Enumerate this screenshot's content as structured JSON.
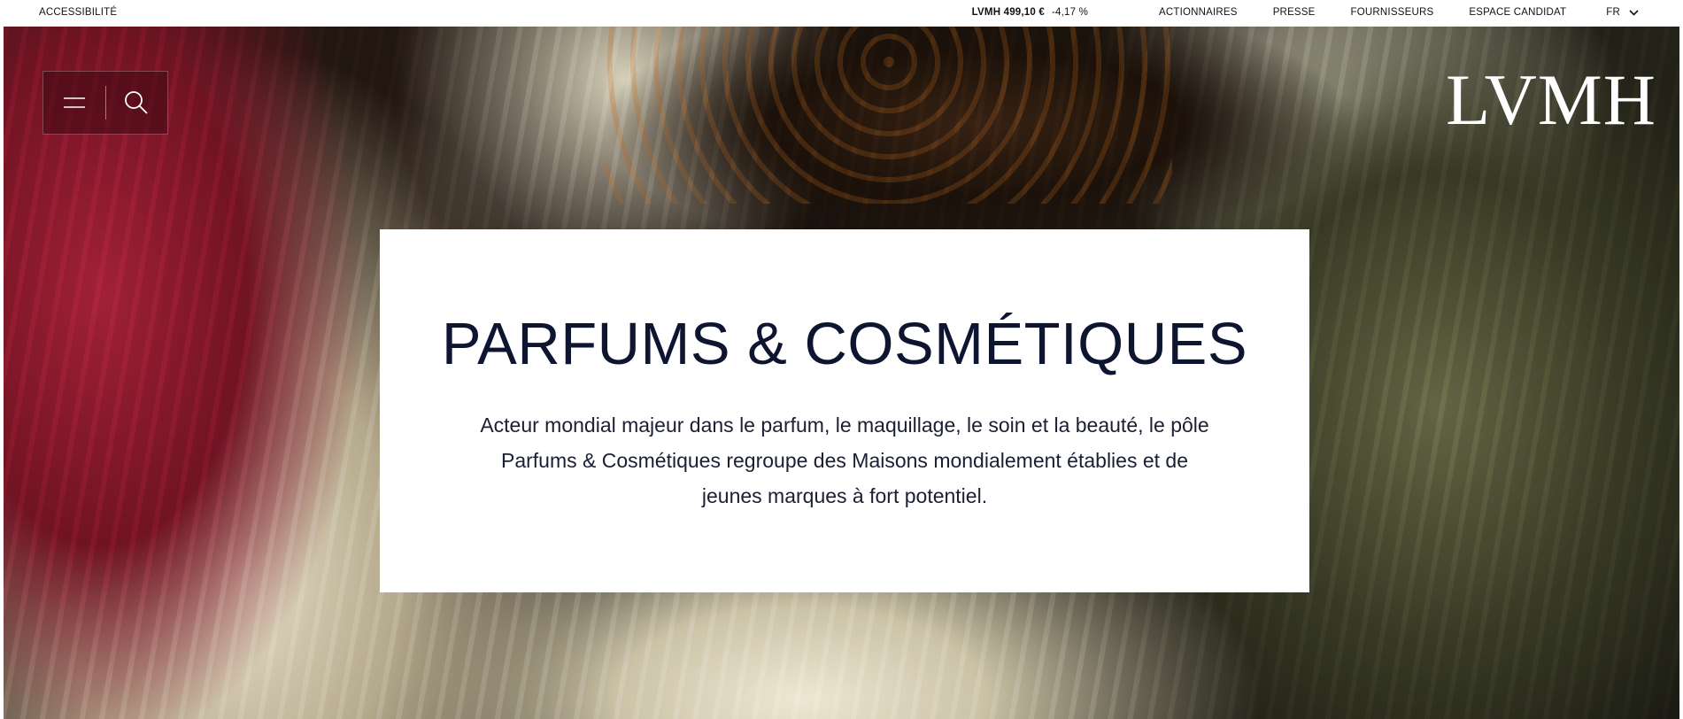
{
  "topbar": {
    "accessibility": "ACCESSIBILITÉ",
    "stock_price": "LVMH 499,10 €",
    "stock_change": "-4,17 %",
    "links": [
      "ACTIONNAIRES",
      "PRESSE",
      "FOURNISSEURS",
      "ESPACE CANDIDAT"
    ],
    "language": "FR"
  },
  "header": {
    "logo": "LVMH",
    "menu_icon": "hamburger-menu-icon",
    "search_icon": "search-icon"
  },
  "hero": {
    "title": "PARFUMS & COSMÉTIQUES",
    "description": "Acteur mondial majeur dans le parfum, le maquillage, le soin et la beauté, le pôle Parfums & Cosmétiques regroupe des Maisons mondialement établies et de jeunes marques à fort potentiel."
  },
  "colors": {
    "title": "#0e1530",
    "card_bg": "#ffffff",
    "logo": "#ffffff"
  }
}
